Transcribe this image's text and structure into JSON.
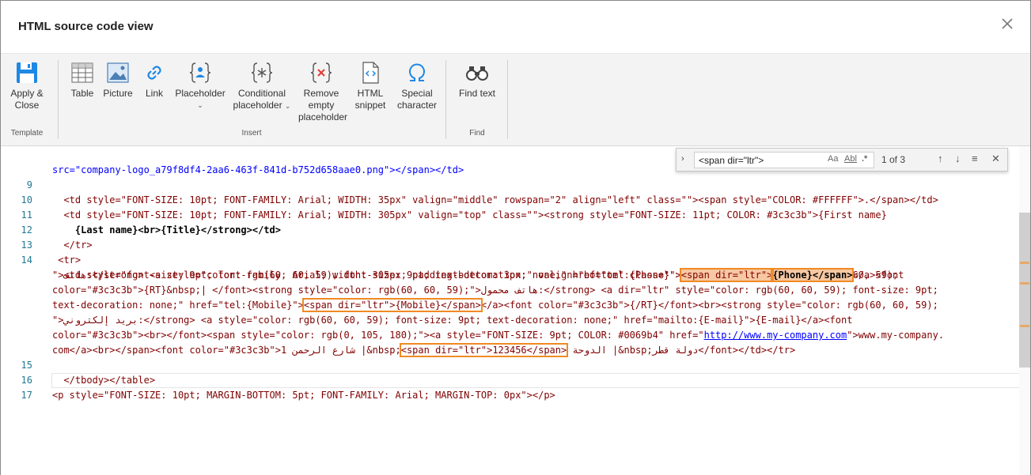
{
  "window": {
    "title": "HTML source code view"
  },
  "ribbon": {
    "template": {
      "label": "Template",
      "apply_close": [
        "Apply &",
        "Close"
      ]
    },
    "insert": {
      "label": "Insert",
      "table": "Table",
      "picture": "Picture",
      "link": "Link",
      "placeholder": "Placeholder",
      "conditional": [
        "Conditional",
        "placeholder"
      ],
      "remove_empty": [
        "Remove",
        "empty",
        "placeholder"
      ],
      "html_snippet": [
        "HTML",
        "snippet"
      ],
      "special_char": [
        "Special",
        "character"
      ]
    },
    "find": {
      "label": "Find",
      "find_text": "Find text"
    }
  },
  "find_widget": {
    "query": "<span dir=\"ltr\">",
    "match_case": "Aa",
    "whole_word": "Abl",
    "regex": ".*",
    "count": "1 of 3"
  },
  "gutter": {
    "n9": "9",
    "n10": "10",
    "n11": "11",
    "n12": "12",
    "n13": "13",
    "n14": "14",
    "n15": "15",
    "n16": "16",
    "n17": "17"
  },
  "code": {
    "l0": "src=\"company-logo_a79f8df4-2aa6-463f-841d-b752d658aae0.png\"></span></td>",
    "l9": "  <td style=\"FONT-SIZE: 10pt; FONT-FAMILY: Arial; WIDTH: 35px\" valign=\"middle\" rowspan=\"2\" align=\"left\" class=\"\"><span style=\"COLOR: #FFFFFF\">.</span></td>",
    "l10": "  <td style=\"FONT-SIZE: 10pt; FONT-FAMILY: Arial; WIDTH: 305px\" valign=\"top\" class=\"\"><strong style=\"FONT-SIZE: 11pt; COLOR: #3c3c3b\">{First name}",
    "l10b": "    {Last name}<br>{Title}</strong></td>",
    "l12": "  </tr>",
    "l13": " <tr>",
    "l14a": "  <td style=\"font-size: 9pt; font-family: Arial; width: 305px; padding-bottom: 3px;\" valign=\"bottom\" class=\"\"><strong style=\"color: rgb(60, 60, 59);",
    "l14b1": "\">هاتف:</strong> <a style=\"color: rgb(60, 60, 59); font-size: 9pt; text-decoration: none;\" href=\"tel:{Phone}\">",
    "l14b_hl": "<span dir=\"ltr\">",
    "l14b2": "{Phone}</span>",
    "l14b3": "</a><font",
    "l14c": "color=\"#3c3c3b\">{RT}&nbsp;| </font><strong style=\"color: rgb(60, 60, 59);\">هاتف محمول:</strong> <a dir=\"ltr\" style=\"color: rgb(60, 60, 59); font-size: 9pt;",
    "l14d1": "text-decoration: none;\" href=\"tel:{Mobile}\">",
    "l14d_hl": "<span dir=\"ltr\">{Mobile}</span>",
    "l14d2": "</a><font color=\"#3c3c3b\">{/RT}</font><br><strong style=\"color: rgb(60, 60, 59);",
    "l14e": "\">بريد إلكتروني:</strong> <a style=\"color: rgb(60, 60, 59); font-size: 9pt; text-decoration: none;\" href=\"mailto:{E-mail}\">{E-mail}</a><font",
    "l14f1": "color=\"#3c3c3b\"><br></font><span style=\"color: rgb(0, 105, 180);\"><a style=\"FONT-SIZE: 9pt; COLOR: #0069b4\" href=\"",
    "l14f_link": "http://www.my-company.com",
    "l14f2": "\">www.my-company.",
    "l14g1": "com</a><br></span><font color=\"#3c3c3b\">شارع الرحمن 1 |&nbsp;",
    "l14g_hl": "<span dir=\"ltr\">123456</span>",
    "l14g2": " الدوحة |&nbsp;دولة قطر</font></td></tr>",
    "l15": "  </tbody></table>",
    "l16": "<p style=\"FONT-SIZE: 10pt; MARGIN-BOTTOM: 5pt; FONT-FAMILY: Arial; MARGIN-TOP: 0px\"></p>",
    "l17": ""
  },
  "colors": {
    "highlight": "#f08a24",
    "tag": "#800000",
    "attr": "#e50000",
    "value": "#0000ff"
  }
}
